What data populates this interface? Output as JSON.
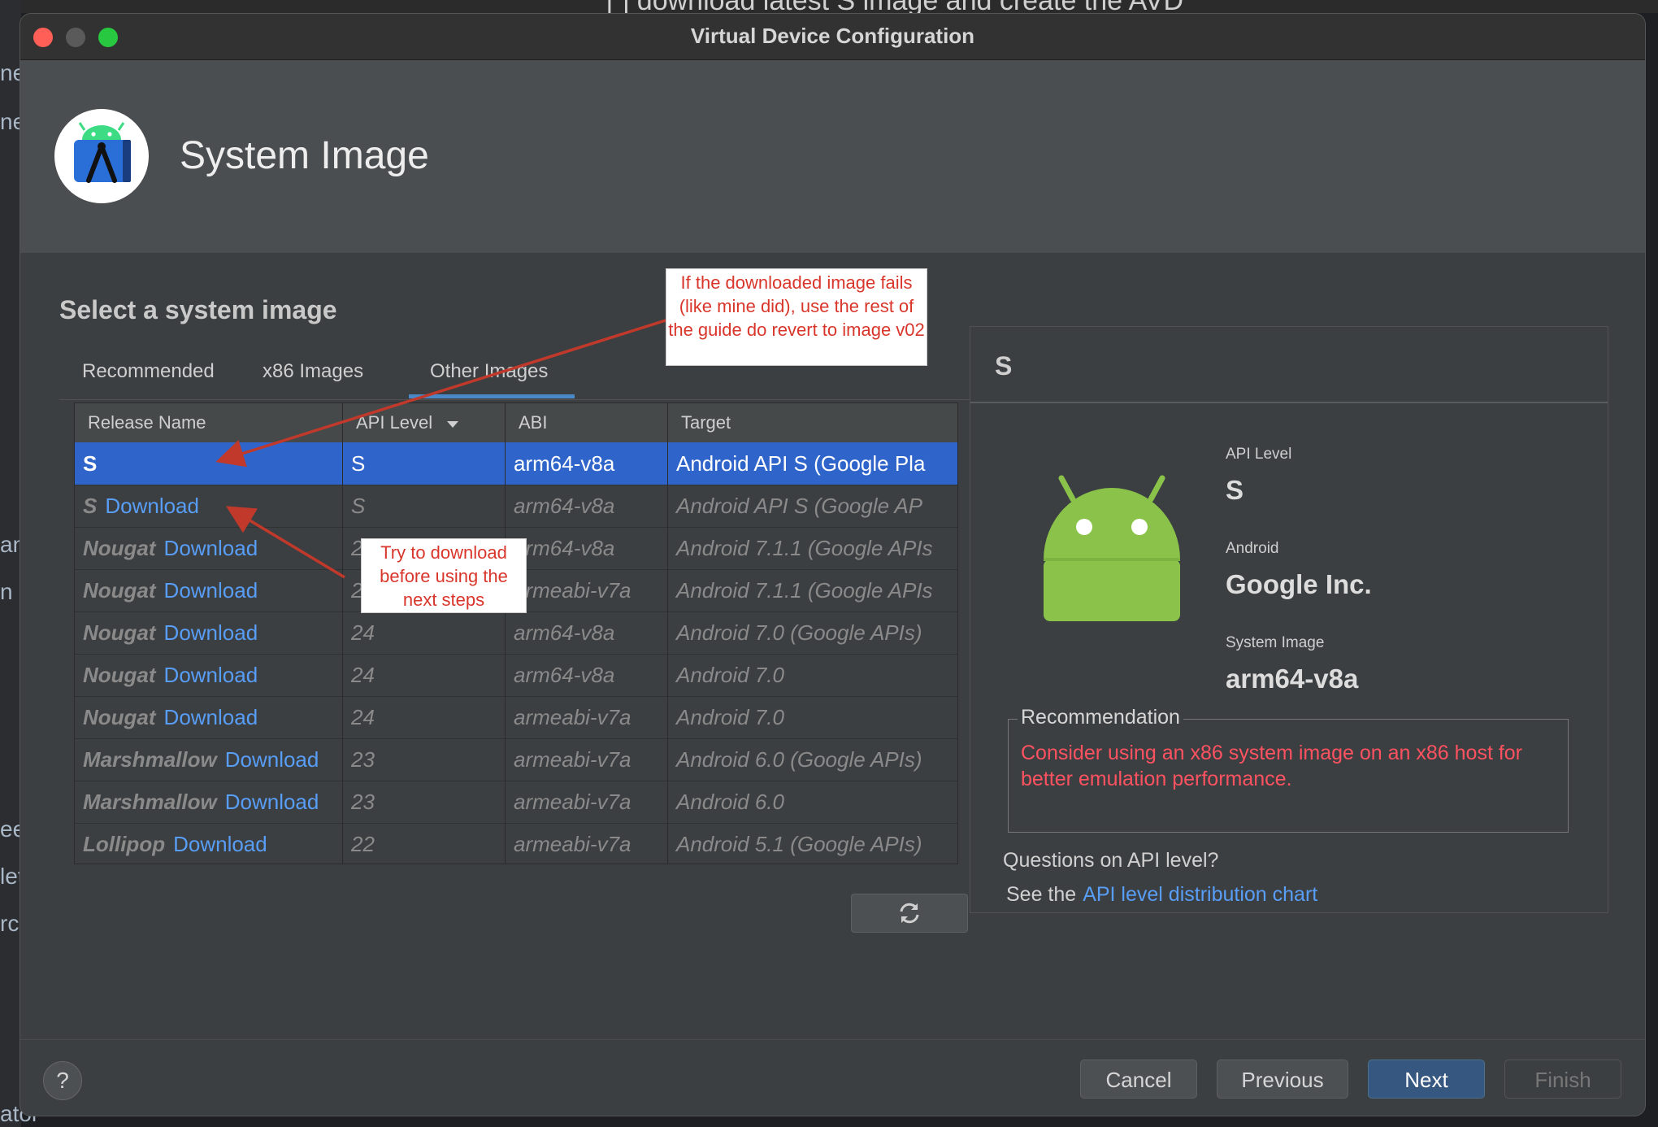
{
  "background": {
    "top_text": "[ ] download latest S image and create the AVD",
    "side_fragments": [
      "ne",
      "ne",
      "an",
      "n e",
      "eel",
      "let",
      "rc",
      "ator"
    ]
  },
  "window": {
    "title": "Virtual Device Configuration"
  },
  "header": {
    "page_title": "System Image",
    "logo_icon": "android-studio-logo-icon"
  },
  "section_title": "Select a system image",
  "tabs": [
    {
      "label": "Recommended",
      "active": false
    },
    {
      "label": "x86 Images",
      "active": false
    },
    {
      "label": "Other Images",
      "active": true
    }
  ],
  "table": {
    "columns": [
      "Release Name",
      "API Level",
      "ABI",
      "Target"
    ],
    "sort_icon": "sort-descending-icon",
    "rows": [
      {
        "name": "S",
        "download": "",
        "api": "S",
        "abi": "arm64-v8a",
        "target": "Android API S (Google Pla",
        "selected": true
      },
      {
        "name": "S",
        "download": "Download",
        "api": "S",
        "abi": "arm64-v8a",
        "target": "Android API S (Google AP",
        "selected": false
      },
      {
        "name": "Nougat",
        "download": "Download",
        "api": "25",
        "abi": "arm64-v8a",
        "target": "Android 7.1.1 (Google APIs",
        "selected": false
      },
      {
        "name": "Nougat",
        "download": "Download",
        "api": "25",
        "abi": "armeabi-v7a",
        "target": "Android 7.1.1 (Google APIs",
        "selected": false
      },
      {
        "name": "Nougat",
        "download": "Download",
        "api": "24",
        "abi": "arm64-v8a",
        "target": "Android 7.0 (Google APIs)",
        "selected": false
      },
      {
        "name": "Nougat",
        "download": "Download",
        "api": "24",
        "abi": "arm64-v8a",
        "target": "Android 7.0",
        "selected": false
      },
      {
        "name": "Nougat",
        "download": "Download",
        "api": "24",
        "abi": "armeabi-v7a",
        "target": "Android 7.0",
        "selected": false
      },
      {
        "name": "Marshmallow",
        "download": "Download",
        "api": "23",
        "abi": "armeabi-v7a",
        "target": "Android 6.0 (Google APIs)",
        "selected": false
      },
      {
        "name": "Marshmallow",
        "download": "Download",
        "api": "23",
        "abi": "armeabi-v7a",
        "target": "Android 6.0",
        "selected": false
      },
      {
        "name": "Lollipop",
        "download": "Download",
        "api": "22",
        "abi": "armeabi-v7a",
        "target": "Android 5.1 (Google APIs)",
        "selected": false
      }
    ]
  },
  "refresh_icon": "refresh-icon",
  "details": {
    "title": "S",
    "robot_icon": "android-robot-icon",
    "api_level_label": "API Level",
    "api_level_value": "S",
    "android_label": "Android",
    "android_value": "Google Inc.",
    "system_image_label": "System Image",
    "system_image_value": "arm64-v8a",
    "recommendation_title": "Recommendation",
    "recommendation_text": "Consider using an x86 system image on an x86 host for better emulation performance.",
    "question": "Questions on API level?",
    "see_prefix": "See the",
    "link": "API level distribution chart"
  },
  "footer": {
    "help": "?",
    "cancel": "Cancel",
    "previous": "Previous",
    "next": "Next",
    "finish": "Finish"
  },
  "annotations": {
    "note1": "If the downloaded image fails (like mine did), use the rest of the guide do revert to image v02",
    "note2": "Try to download before using the next steps",
    "color": "#d9362b"
  }
}
